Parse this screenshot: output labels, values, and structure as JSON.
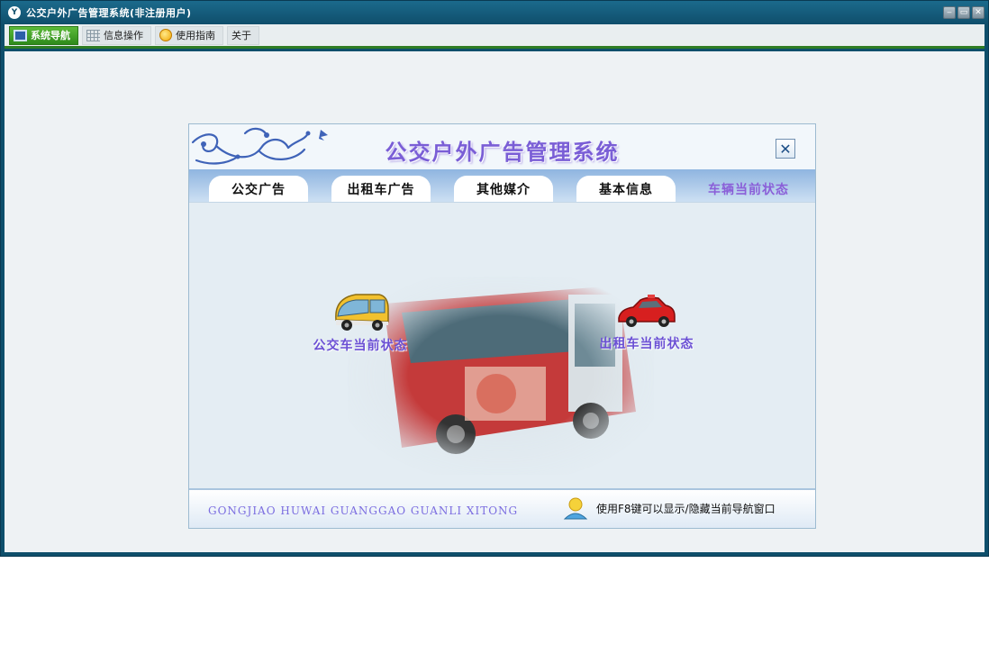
{
  "window": {
    "logo": "Y",
    "title": "公交户外广告管理系统(非注册用户)",
    "controls": [
      "‒",
      "▭",
      "✕"
    ]
  },
  "menu": [
    {
      "label": "系统导航",
      "icon": "monitor-icon",
      "active": true
    },
    {
      "label": "信息操作",
      "icon": "grid-icon",
      "active": false
    },
    {
      "label": "使用指南",
      "icon": "guide-icon",
      "active": false
    },
    {
      "label": "关于",
      "icon": "",
      "active": false
    }
  ],
  "panel": {
    "title": "公交户外广告管理系统",
    "close": "✕",
    "tabs": [
      "公交广告",
      "出租车广告",
      "其他媒介",
      "基本信息",
      "车辆当前状态"
    ],
    "items": {
      "bus": "公交车当前状态",
      "taxi": "出租车当前状态"
    },
    "footer_pinyin": "GONGJIAO HUWAI GUANGGAO GUANLI XITONG",
    "footer_hint": "使用F8键可以显示/隐藏当前导航窗口"
  },
  "colors": {
    "title_bar": "#0f4e6b",
    "menu_active": "#2e8a1b",
    "panel_title": "#7a5ed6",
    "item_label": "#6a4fd4"
  }
}
